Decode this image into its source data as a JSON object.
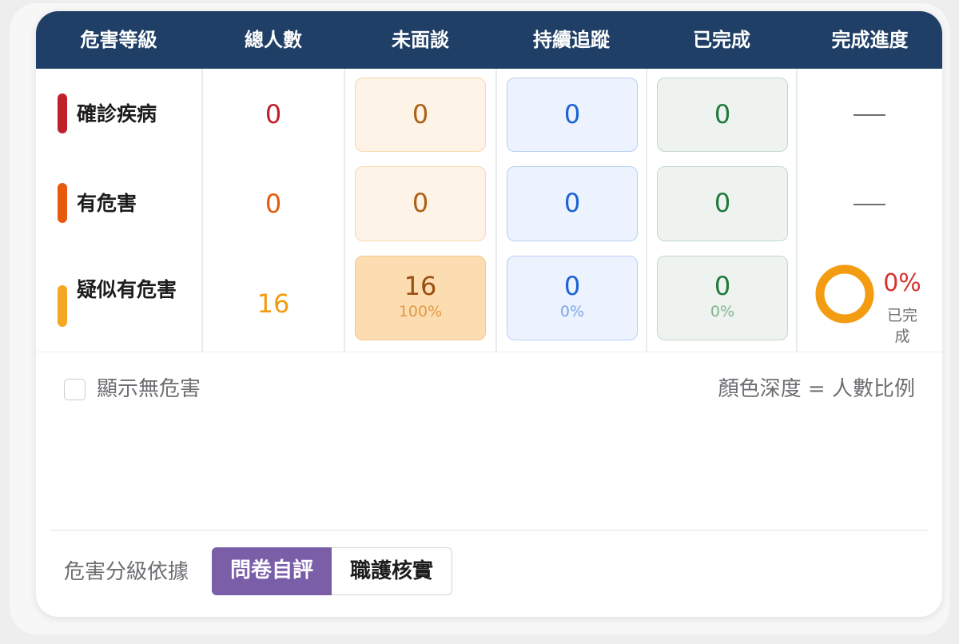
{
  "header": {
    "grade": "危害等級",
    "total": "總人數",
    "not_interviewed": "未面談",
    "tracking": "持續追蹤",
    "completed": "已完成",
    "progress": "完成進度"
  },
  "rows": [
    {
      "grade": "確診疾病",
      "color": "#c0202a",
      "total": "0",
      "not_interviewed": "0",
      "tracking": "0",
      "completed": "0",
      "progress": "—"
    },
    {
      "grade": "有危害",
      "color": "#e8590c",
      "total": "0",
      "not_interviewed": "0",
      "tracking": "0",
      "completed": "0",
      "progress": "—"
    },
    {
      "grade": "疑似有危害",
      "color": "#f5a623",
      "total": "16",
      "not_interviewed": "16",
      "not_interviewed_pct": "100%",
      "tracking": "0",
      "tracking_pct": "0%",
      "completed": "0",
      "completed_pct": "0%",
      "progress_value": "0%",
      "progress_label": "已完成",
      "progress_fraction": 0
    }
  ],
  "footer": {
    "show_none_label": "顯示無危害",
    "show_none_checked": false,
    "legend": "顏色深度 = 人數比例"
  },
  "basis": {
    "label": "危害分級依據",
    "options": [
      "問卷自評",
      "職護核實"
    ],
    "selected": "問卷自評"
  },
  "colors": {
    "header_bg": "#1f3f66",
    "orange_box_bg": "#fdf3e6",
    "orange_box_strong_bg": "#fcdcb1",
    "blue_box_bg": "#edf3fe",
    "green_box_bg": "#eef3ef",
    "active_toggle": "#7a5ea8",
    "progress_ring": "#f39c12",
    "progress_text": "#d6332f"
  }
}
